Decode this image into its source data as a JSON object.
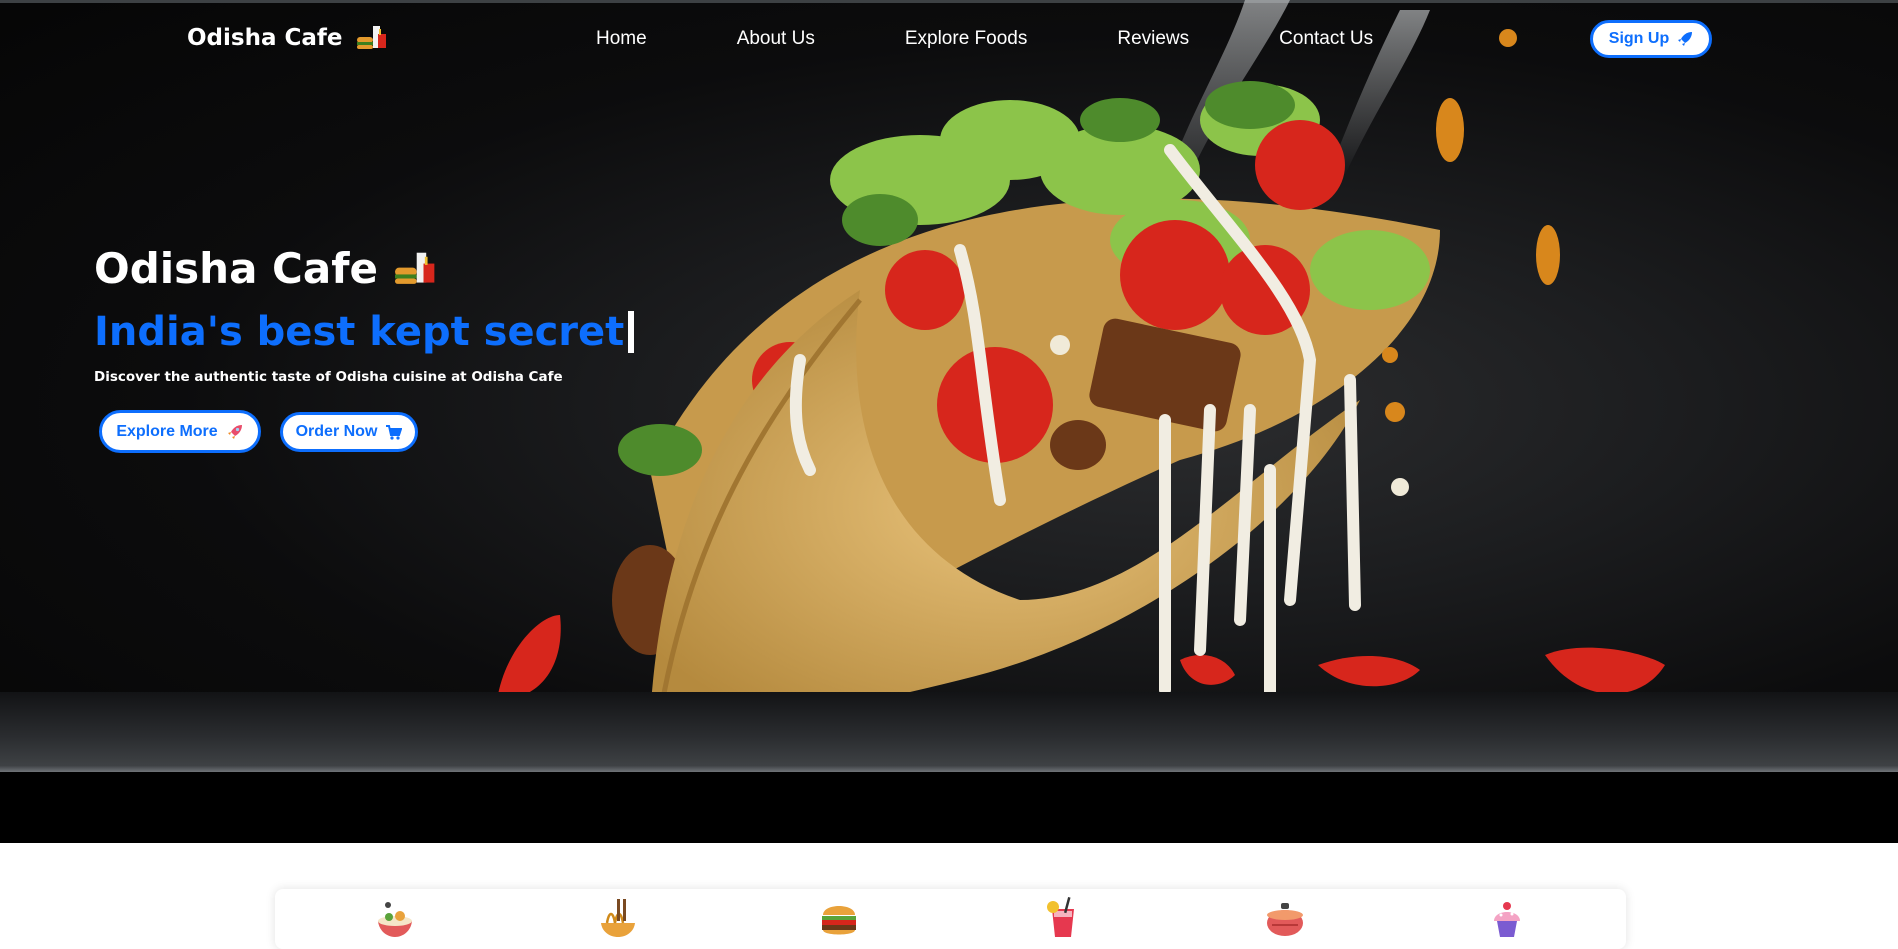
{
  "brand": {
    "name": "Odisha Cafe",
    "icon": "fast-food-icon"
  },
  "nav": {
    "links": [
      "Home",
      "About Us",
      "Explore Foods",
      "Reviews",
      "Contact Us"
    ],
    "signup_label": "Sign Up",
    "signup_icon": "rocket-icon"
  },
  "hero": {
    "title": "Odisha Cafe",
    "title_icon": "fast-food-icon",
    "tagline": "India's best kept secret",
    "description": "Discover the authentic taste of Odisha cuisine at Odisha Cafe",
    "explore_label": "Explore More",
    "explore_icon": "rocket-icon",
    "order_label": "Order Now",
    "order_icon": "cart-icon",
    "image": "taco-photo"
  },
  "categories": [
    {
      "icon": "rice-bowl-icon"
    },
    {
      "icon": "noodles-icon"
    },
    {
      "icon": "burger-icon"
    },
    {
      "icon": "drink-icon"
    },
    {
      "icon": "curry-pot-icon"
    },
    {
      "icon": "cupcake-icon"
    }
  ],
  "colors": {
    "accent": "#0d6efd",
    "hero_bg": "#0a0a0b",
    "text": "#ffffff"
  }
}
